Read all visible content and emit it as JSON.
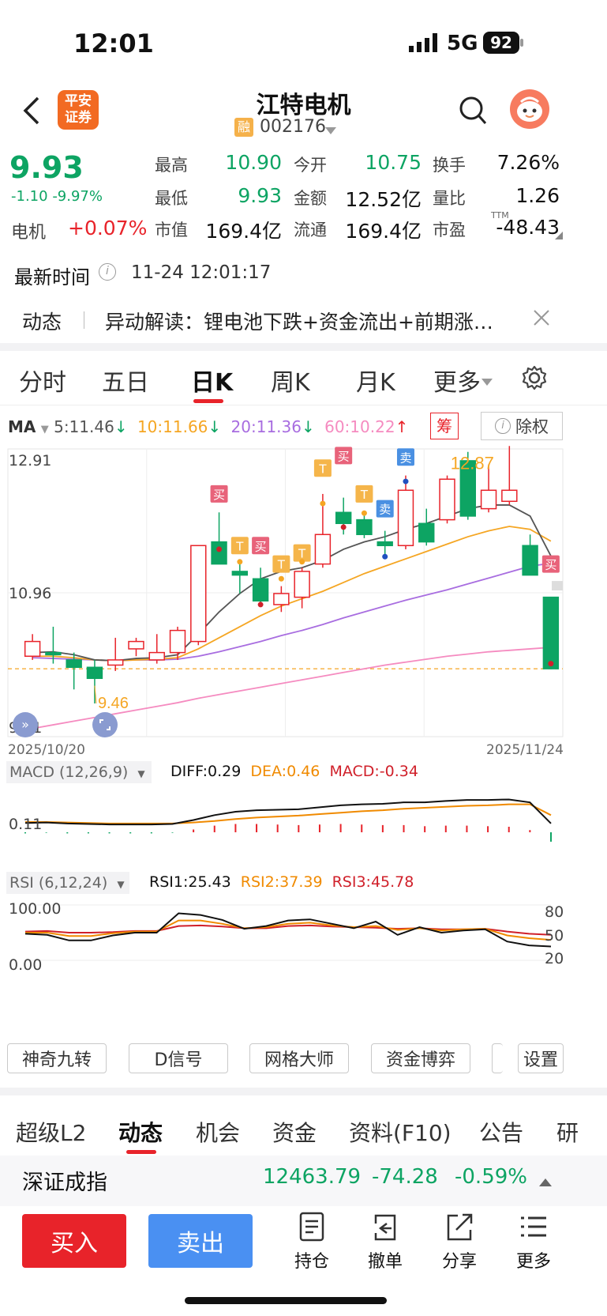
{
  "status_bar": {
    "time": "12:01",
    "network": "5G",
    "battery": "92"
  },
  "header": {
    "title": "江特电机",
    "badge": "融",
    "code": "002176",
    "logo_line1": "平安",
    "logo_line2": "证券"
  },
  "quote": {
    "price": "9.93",
    "change": "-1.10",
    "change_pct": "-9.97%",
    "sector_name": "电机",
    "sector_pct": "+0.07%",
    "fields": [
      {
        "label": "最高",
        "value": "10.90",
        "color": "green"
      },
      {
        "label": "今开",
        "value": "10.75",
        "color": "green"
      },
      {
        "label": "换手",
        "value": "7.26%",
        "color": "black"
      },
      {
        "label": "最低",
        "value": "9.93",
        "color": "green"
      },
      {
        "label": "金额",
        "value": "12.52亿",
        "color": "black"
      },
      {
        "label": "量比",
        "value": "1.26",
        "color": "black"
      },
      {
        "label": "市值",
        "value": "169.4亿",
        "color": "black"
      },
      {
        "label": "流通",
        "value": "169.4亿",
        "color": "black"
      },
      {
        "label": "市盈",
        "value": "-48.43",
        "color": "black"
      }
    ],
    "ttm": "TTM",
    "latest_time_label": "最新时间",
    "latest_time": "11-24 12:01:17"
  },
  "news": {
    "tag": "动态",
    "text": "异动解读：锂电池下跌+资金流出+前期涨…"
  },
  "chart_tabs": [
    "分时",
    "五日",
    "日K",
    "周K",
    "月K",
    "更多"
  ],
  "active_tab": "日K",
  "ma_legend": {
    "label": "MA",
    "ma5": "5:11.46",
    "ma10": "10:11.66",
    "ma20": "20:11.36",
    "ma60": "60:10.22",
    "chip": "筹",
    "adjust": "除权"
  },
  "colors": {
    "up": "#e8232a",
    "down": "#0da463",
    "ma5": "#555555",
    "ma10": "#f5a623",
    "ma20": "#a86de0",
    "ma60": "#f58bc0",
    "accent_blue": "#4a90e2"
  },
  "chart_data": {
    "type": "candlestick",
    "y_max_label": "12.91",
    "y_mid_label": "10.96",
    "y_min_label": "9.01",
    "ylim": [
      9.01,
      12.91
    ],
    "date_start": "2025/10/20",
    "date_end": "2025/11/24",
    "high_mark": "12.87",
    "low_mark": "9.46",
    "candles": [
      {
        "o": 10.1,
        "c": 10.3,
        "h": 10.4,
        "l": 10.05
      },
      {
        "o": 10.15,
        "c": 10.12,
        "h": 10.5,
        "l": 10.0
      },
      {
        "o": 10.05,
        "c": 9.95,
        "h": 10.15,
        "l": 9.65
      },
      {
        "o": 9.95,
        "c": 9.8,
        "h": 10.05,
        "l": 9.46
      },
      {
        "o": 9.98,
        "c": 10.05,
        "h": 10.35,
        "l": 9.9
      },
      {
        "o": 10.2,
        "c": 10.3,
        "h": 10.35,
        "l": 10.1
      },
      {
        "o": 10.05,
        "c": 10.15,
        "h": 10.4,
        "l": 10.0
      },
      {
        "o": 10.15,
        "c": 10.45,
        "h": 10.5,
        "l": 10.05
      },
      {
        "o": 10.3,
        "c": 11.6,
        "h": 11.6,
        "l": 10.25
      },
      {
        "o": 11.65,
        "c": 11.35,
        "h": 12.05,
        "l": 11.35
      },
      {
        "o": 11.25,
        "c": 11.2,
        "h": 11.35,
        "l": 10.95
      },
      {
        "o": 11.15,
        "c": 10.85,
        "h": 11.3,
        "l": 10.8
      },
      {
        "o": 10.8,
        "c": 10.95,
        "h": 11.05,
        "l": 10.7
      },
      {
        "o": 10.9,
        "c": 11.25,
        "h": 11.3,
        "l": 10.75
      },
      {
        "o": 11.35,
        "c": 11.75,
        "h": 12.3,
        "l": 11.3
      },
      {
        "o": 12.05,
        "c": 11.9,
        "h": 12.25,
        "l": 11.75
      },
      {
        "o": 11.95,
        "c": 11.75,
        "h": 12.05,
        "l": 11.7
      },
      {
        "o": 11.65,
        "c": 11.6,
        "h": 11.8,
        "l": 11.45
      },
      {
        "o": 11.6,
        "c": 12.35,
        "h": 12.55,
        "l": 11.55
      },
      {
        "o": 11.9,
        "c": 11.65,
        "h": 12.1,
        "l": 11.6
      },
      {
        "o": 11.95,
        "c": 12.5,
        "h": 12.55,
        "l": 11.9
      },
      {
        "o": 12.75,
        "c": 12.0,
        "h": 12.87,
        "l": 11.95
      },
      {
        "o": 12.1,
        "c": 12.35,
        "h": 12.7,
        "l": 12.05
      },
      {
        "o": 12.2,
        "c": 12.35,
        "h": 12.95,
        "l": 12.15
      },
      {
        "o": 11.6,
        "c": 11.2,
        "h": 11.75,
        "l": 11.2
      },
      {
        "o": 10.9,
        "c": 9.93,
        "h": 10.9,
        "l": 9.93
      }
    ],
    "ma5": [
      10.15,
      10.16,
      10.12,
      10.05,
      10.04,
      10.07,
      10.08,
      10.12,
      10.4,
      10.7,
      10.95,
      11.15,
      11.25,
      11.3,
      11.4,
      11.55,
      11.65,
      11.72,
      11.82,
      11.9,
      12.0,
      12.1,
      12.15,
      12.15,
      12.0,
      11.46
    ],
    "ma10": [
      10.1,
      10.1,
      10.08,
      10.05,
      10.04,
      10.05,
      10.06,
      10.08,
      10.2,
      10.35,
      10.5,
      10.65,
      10.78,
      10.88,
      10.98,
      11.1,
      11.22,
      11.32,
      11.42,
      11.52,
      11.62,
      11.72,
      11.8,
      11.86,
      11.82,
      11.66
    ],
    "ma20": [
      10.08,
      10.07,
      10.06,
      10.05,
      10.04,
      10.05,
      10.05,
      10.06,
      10.1,
      10.16,
      10.23,
      10.3,
      10.38,
      10.45,
      10.53,
      10.62,
      10.7,
      10.78,
      10.86,
      10.93,
      11.0,
      11.08,
      11.16,
      11.24,
      11.32,
      11.36
    ],
    "ma60": [
      9.12,
      9.17,
      9.22,
      9.27,
      9.32,
      9.37,
      9.42,
      9.47,
      9.53,
      9.58,
      9.63,
      9.68,
      9.73,
      9.78,
      9.83,
      9.88,
      9.93,
      9.98,
      10.02,
      10.06,
      10.1,
      10.13,
      10.16,
      10.18,
      10.2,
      10.22
    ],
    "signals": [
      {
        "i": 9,
        "t": "买",
        "kind": "buy",
        "price": 12.3
      },
      {
        "i": 10,
        "t": "T",
        "kind": "t",
        "price": 11.6
      },
      {
        "i": 11,
        "t": "买",
        "kind": "buy",
        "price": 11.6
      },
      {
        "i": 12,
        "t": "T",
        "kind": "t",
        "price": 11.35
      },
      {
        "i": 13,
        "t": "T",
        "kind": "t",
        "price": 11.5
      },
      {
        "i": 14,
        "t": "T",
        "kind": "t",
        "price": 12.65
      },
      {
        "i": 15,
        "t": "买",
        "kind": "buy",
        "price": 12.82
      },
      {
        "i": 16,
        "t": "T",
        "kind": "t",
        "price": 12.3
      },
      {
        "i": 17,
        "t": "卖",
        "kind": "sell",
        "price": 12.1
      },
      {
        "i": 18,
        "t": "卖",
        "kind": "sell",
        "price": 12.8
      },
      {
        "i": 25,
        "t": "买",
        "kind": "buy",
        "price": 11.35
      }
    ]
  },
  "macd": {
    "label": "MACD (12,26,9)",
    "diff": "DIFF:0.29",
    "dea": "DEA:0.46",
    "macd": "MACD:-0.34",
    "axis": "0.11"
  },
  "rsi": {
    "label": "RSI (6,12,24)",
    "rsi1": "RSI1:25.43",
    "rsi2": "RSI2:37.39",
    "rsi3": "RSI3:45.78",
    "top": "100.00",
    "bottom": "0.00",
    "r80": "80",
    "r50": "50",
    "r20": "20"
  },
  "indicator_buttons": [
    "神奇九转",
    "D信号",
    "网格大师",
    "资金博弈"
  ],
  "settings_label": "设置",
  "bottom_tabs": [
    "超级L2",
    "动态",
    "机会",
    "资金",
    "资料(F10)",
    "公告",
    "研"
  ],
  "active_bottom_tab": "动态",
  "index_bar": {
    "name": "深证成指",
    "value": "12463.79",
    "change": "-74.28",
    "pct": "-0.59%"
  },
  "actions": {
    "buy": "买入",
    "sell": "卖出",
    "hold": "持仓",
    "cancel": "撤单",
    "share": "分享",
    "more": "更多"
  }
}
